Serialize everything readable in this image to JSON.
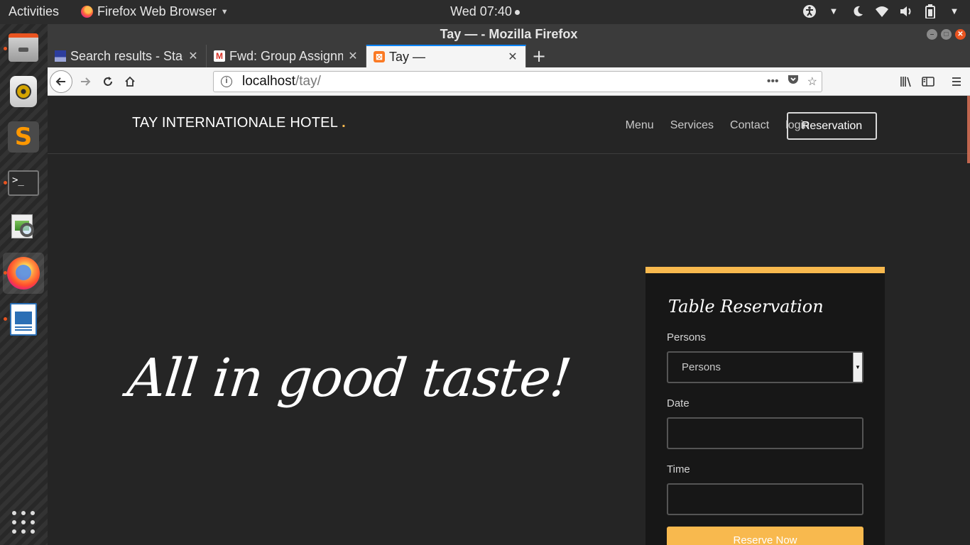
{
  "topbar": {
    "activities": "Activities",
    "app_name": "Firefox Web Browser",
    "clock": "Wed 07:40"
  },
  "window": {
    "title": "Tay — - Mozilla Firefox"
  },
  "tabs": [
    {
      "title": "Search results - Stac",
      "favicon": "stackoverflow-icon"
    },
    {
      "title": "Fwd: Group Assignm",
      "favicon": "gmail-icon"
    },
    {
      "title": "Tay —",
      "favicon": "xampp-icon",
      "selected": true
    }
  ],
  "url": {
    "host": "localhost",
    "path": "/tay/"
  },
  "site": {
    "brand": "TAY INTERNATIONALE HOTEL",
    "brand_dot": ".",
    "nav": [
      "Menu",
      "Services",
      "Contact",
      "login"
    ],
    "reservation_button": "Reservation",
    "hero": "All in good taste!"
  },
  "reservation_form": {
    "title": "Table Reservation",
    "persons_label": "Persons",
    "persons_value": "Persons",
    "date_label": "Date",
    "date_value": "",
    "time_label": "Time",
    "time_value": "",
    "submit": "Reserve Now"
  },
  "colors": {
    "accent": "#f8b94e",
    "page_bg": "#252525",
    "card_bg": "#171717",
    "ubuntu_orange": "#e95420"
  }
}
